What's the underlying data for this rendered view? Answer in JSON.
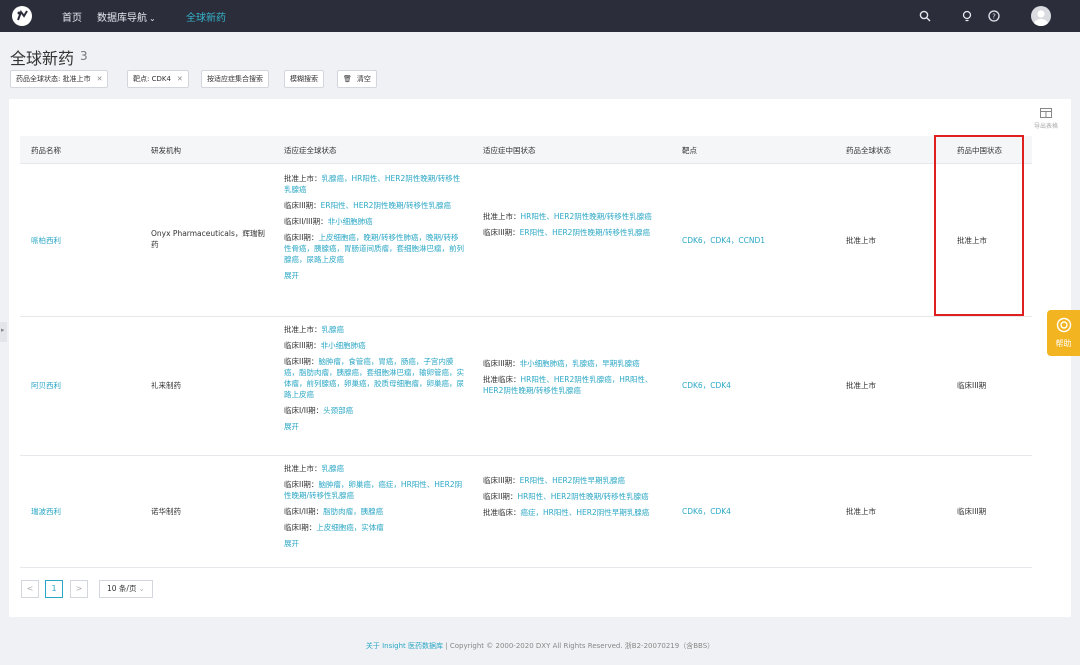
{
  "nav": {
    "home": "首页",
    "database_nav": "数据库导航",
    "global_new_drugs": "全球新药"
  },
  "page": {
    "title": "全球新药",
    "count": "3"
  },
  "filters": {
    "status_chip": "药品全球状态: 批准上市",
    "target_chip": "靶点: CDK4",
    "indication_search": "按适应症集合搜索",
    "fuzzy_search": "模糊搜索",
    "clear": "清空"
  },
  "export_label": "导出表格",
  "table": {
    "headers": [
      "药品名称",
      "研发机构",
      "适应症全球状态",
      "适应症中国状态",
      "靶点",
      "药品全球状态",
      "药品中国状态"
    ],
    "rows": [
      {
        "name": "哌柏西利",
        "org": "Onyx Pharmaceuticals，辉瑞制药",
        "global": [
          {
            "label": "批准上市：",
            "text": "乳腺癌，HR阳性、HER2阴性晚期/转移性乳腺癌"
          },
          {
            "label": "临床III期：",
            "text": "ER阳性、HER2阴性晚期/转移性乳腺癌"
          },
          {
            "label": "临床II/III期：",
            "text": "非小细胞肺癌"
          },
          {
            "label": "临床II期：",
            "text": "上皮细胞癌，晚期/转移性肺癌，晚期/转移性骨癌，胰腺癌，胃肠道间质瘤，套细胞淋巴瘤，前列腺癌，尿路上皮癌"
          }
        ],
        "expand": "展开",
        "china": [
          {
            "label": "批准上市：",
            "text": "HR阳性、HER2阴性晚期/转移性乳腺癌"
          },
          {
            "label": "临床III期：",
            "text": "ER阳性、HER2阴性晚期/转移性乳腺癌"
          }
        ],
        "target": "CDK6，CDK4，CCND1",
        "global_status": "批准上市",
        "china_status": "批准上市"
      },
      {
        "name": "阿贝西利",
        "org": "礼来制药",
        "global": [
          {
            "label": "批准上市：",
            "text": "乳腺癌"
          },
          {
            "label": "临床III期：",
            "text": "非小细胞肺癌"
          },
          {
            "label": "临床II期：",
            "text": "脑肿瘤，食管癌，胃癌，肠癌，子宫内膜癌，脂肪肉瘤，胰腺癌，套细胞淋巴瘤，输卵管癌，实体瘤，前列腺癌，卵巢癌，胶质母细胞瘤，卵巢癌，尿路上皮癌"
          },
          {
            "label": "临床I/II期：",
            "text": "头颈部癌"
          }
        ],
        "expand": "展开",
        "china": [
          {
            "label": "临床III期：",
            "text": "非小细胞肺癌，乳腺癌，早期乳腺癌"
          },
          {
            "label": "批准临床：",
            "text": "HR阳性、HER2阴性乳腺癌，HR阳性、HER2阴性晚期/转移性乳腺癌"
          }
        ],
        "target": "CDK6，CDK4",
        "global_status": "批准上市",
        "china_status": "临床III期"
      },
      {
        "name": "瑞波西利",
        "org": "诺华制药",
        "global": [
          {
            "label": "批准上市：",
            "text": "乳腺癌"
          },
          {
            "label": "临床II期：",
            "text": "脑肿瘤，卵巢癌，癌症，HR阳性、HER2阴性晚期/转移性乳腺癌"
          },
          {
            "label": "临床I/II期：",
            "text": "脂肪肉瘤，胰腺癌"
          },
          {
            "label": "临床I期：",
            "text": "上皮细胞癌，实体瘤"
          }
        ],
        "expand": "展开",
        "china": [
          {
            "label": "临床III期：",
            "text": "ER阳性、HER2阴性早期乳腺癌"
          },
          {
            "label": "临床II期：",
            "text": "HR阳性、HER2阴性晚期/转移性乳腺癌"
          },
          {
            "label": "批准临床：",
            "text": "癌症，HR阳性、HER2阴性早期乳腺癌"
          }
        ],
        "target": "CDK6，CDK4",
        "global_status": "批准上市",
        "china_status": "临床III期"
      }
    ]
  },
  "pagination": {
    "prev": "<",
    "current": "1",
    "next": ">",
    "page_size": "10 条/页"
  },
  "help": "帮助",
  "footer": {
    "about": "关于 Insight 医药数据库",
    "copyright": "Copyright © 2000-2020 DXY All Rights Reserved. 浙B2-20070219（含BBS）"
  },
  "colors": {
    "topbar": "#2b2d3b",
    "accent": "#2ba7c5",
    "highlight": "#e02020",
    "help": "#f2b521"
  },
  "icons": [
    "logo-icon",
    "search-icon",
    "bulb-icon",
    "help-circle-icon",
    "avatar-icon",
    "trash-icon",
    "export-icon",
    "help-icon",
    "chevron-down-icon"
  ]
}
